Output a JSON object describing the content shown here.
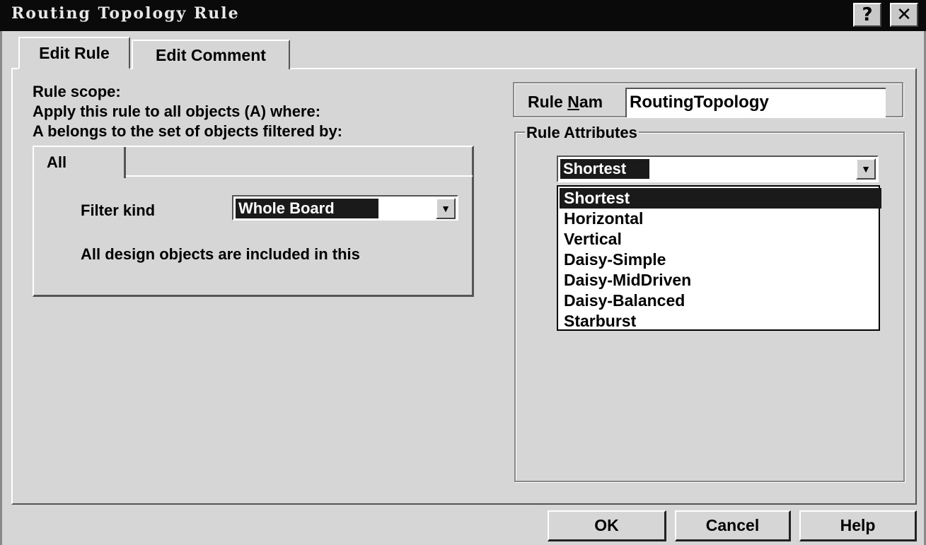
{
  "window": {
    "title": "Routing Topology Rule",
    "help_glyph": "?",
    "close_glyph": "✕"
  },
  "tabs": [
    {
      "label": "Edit Rule",
      "active": true
    },
    {
      "label": "Edit Comment",
      "active": false
    }
  ],
  "scope": {
    "line1": "Rule scope:",
    "line2": "Apply this rule to all objects (A) where:",
    "line3": "A belongs to the set of objects filtered by:"
  },
  "filter": {
    "subtab_label": "All",
    "kind_label": "Filter kind",
    "kind_value": "Whole Board",
    "description": "All design objects are included in this"
  },
  "rule_name": {
    "label_prefix": "Rule ",
    "label_underlined": "N",
    "label_suffix": "am",
    "value": "RoutingTopology"
  },
  "rule_attributes": {
    "legend": "Rule Attributes",
    "selected": "Shortest",
    "options": [
      "Shortest",
      "Horizontal",
      "Vertical",
      "Daisy-Simple",
      "Daisy-MidDriven",
      "Daisy-Balanced",
      "Starburst"
    ]
  },
  "buttons": {
    "ok": "OK",
    "cancel": "Cancel",
    "help": "Help"
  },
  "colors": {
    "dialog_bg": "#d6d6d6",
    "titlebar_bg": "#0a0a0a",
    "selection_bg": "#1a1a1a"
  }
}
